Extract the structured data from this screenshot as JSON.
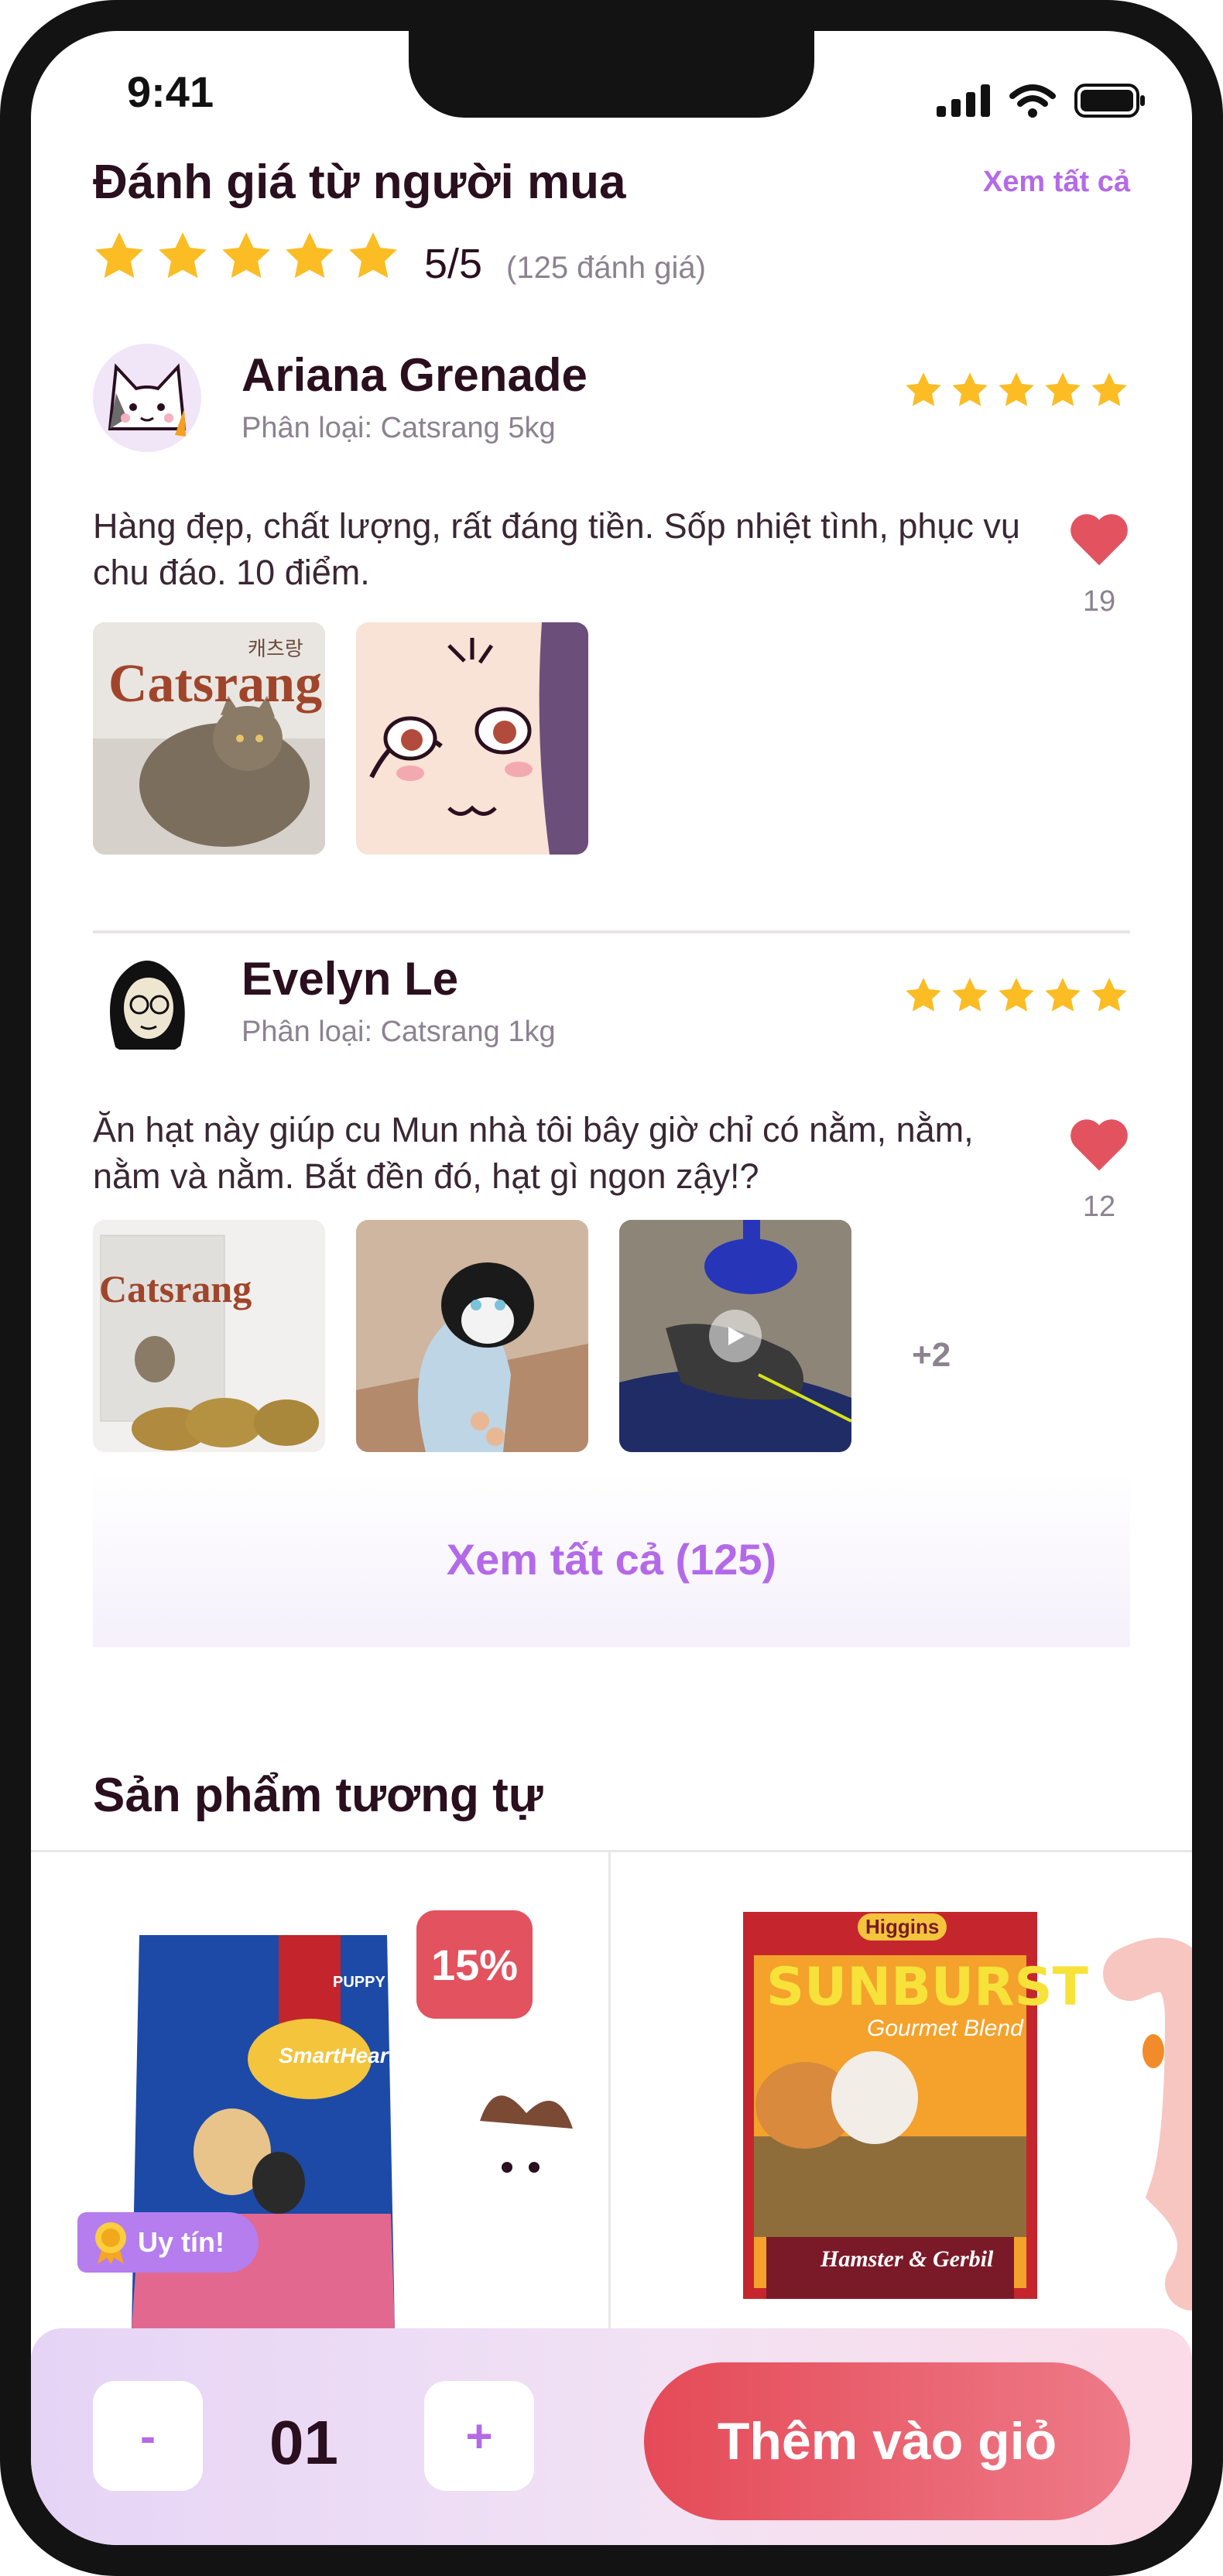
{
  "status": {
    "time": "9:41"
  },
  "reviews_section": {
    "title": "Đánh giá từ người mua",
    "see_all_link": "Xem tất cả",
    "rating": "5/5",
    "count": "(125 đánh giá)"
  },
  "reviews": [
    {
      "name": "Ariana Grenade",
      "variant": "Phân loại: Catsrang 5kg",
      "text": "Hàng đẹp, chất lượng, rất đáng tiền. Sốp nhiệt tình, phục vụ chu đáo. 10 điểm.",
      "likes": "19",
      "stars": 5
    },
    {
      "name": "Evelyn Le",
      "variant": "Phân loại: Catsrang 1kg",
      "text": "Ăn hạt này giúp cu Mun nhà tôi bây giờ chỉ có nằm, nằm, nằm và nằm. Bắt đền đó, hạt gì ngon zậy!?",
      "likes": "12",
      "stars": 5,
      "more_media": "+2"
    }
  ],
  "thumb_text": {
    "catsrang": "Catsrang",
    "catsrang_kr": "캐츠랑"
  },
  "see_all_button": "Xem tất cả (125)",
  "similar": {
    "title": "Sản phẩm tương tự",
    "discount": "15%",
    "trust_badge": "Uy tín!",
    "product1_brand": "SmartHeart",
    "product1_tag": "PUPPY",
    "product2_brand": "Higgins",
    "product2_name": "SUNBURST",
    "product2_sub": "Gourmet Blend",
    "product2_label": "Hamster & Gerbil"
  },
  "cart": {
    "minus": "-",
    "qty": "01",
    "plus": "+",
    "add_label": "Thêm vào giỏ"
  },
  "colors": {
    "accent": "#b46ae8",
    "heart": "#e2525f",
    "star": "#fbbd23"
  }
}
